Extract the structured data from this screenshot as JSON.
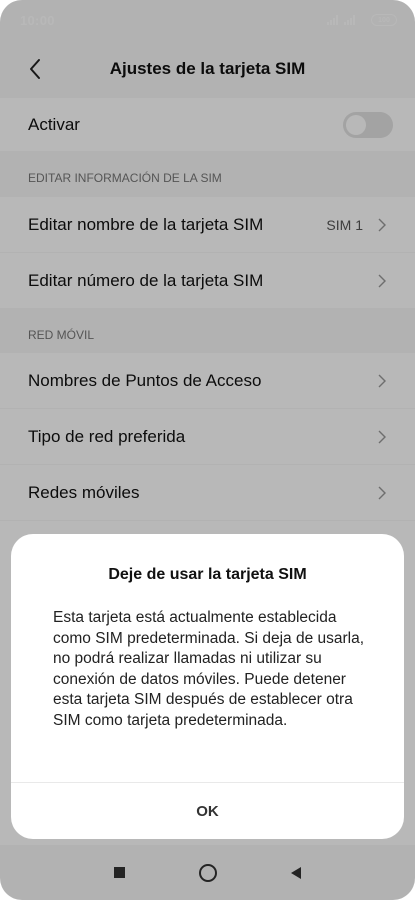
{
  "status_bar": {
    "time": "10:00",
    "battery": "100"
  },
  "header": {
    "title": "Ajustes de la tarjeta SIM",
    "back_icon": "chevron-left-icon"
  },
  "settings": {
    "activate": {
      "label": "Activar",
      "enabled": false
    },
    "section_edit": {
      "header": "EDITAR INFORMACIÓN DE LA SIM",
      "items": [
        {
          "label": "Editar nombre de la tarjeta SIM",
          "value": "SIM 1"
        },
        {
          "label": "Editar número de la tarjeta SIM"
        }
      ]
    },
    "section_network": {
      "header": "RED MÓVIL",
      "items": [
        {
          "label": "Nombres de Puntos de Acceso"
        },
        {
          "label": "Tipo de red preferida"
        },
        {
          "label": "Redes móviles"
        }
      ]
    }
  },
  "dialog": {
    "title": "Deje de usar la tarjeta SIM",
    "message": "Esta tarjeta está actualmente establecida como SIM predeterminada. Si deja de usarla, no podrá realizar llamadas ni utilizar su conexión de datos móviles. Puede detener esta tarjeta SIM después de establecer otra SIM como tarjeta predeterminada.",
    "ok_label": "OK"
  },
  "colors": {
    "background": "#f7f7f7",
    "row": "#ffffff",
    "scrim": "rgba(0,0,0,0.28)"
  }
}
